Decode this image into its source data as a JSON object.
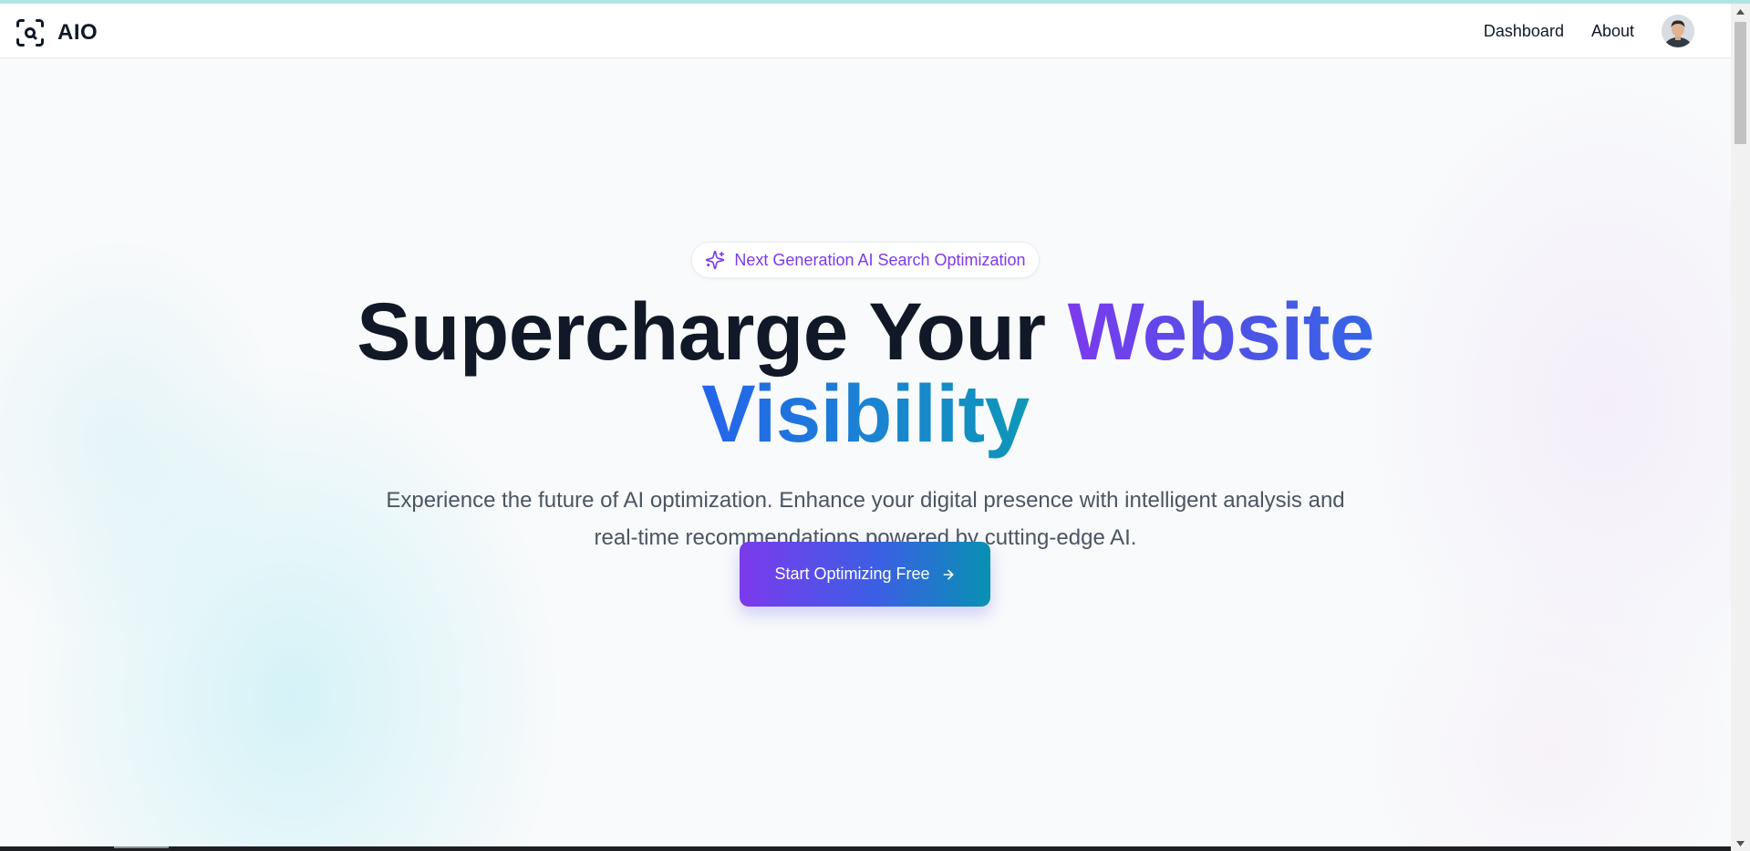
{
  "nav": {
    "brand": "AIO",
    "links": [
      "Dashboard",
      "About"
    ]
  },
  "hero": {
    "badge": "Next Generation AI Search Optimization",
    "headline_plain": "Supercharge Your ",
    "headline_accent_1": "Website",
    "headline_accent_2": "Visibility",
    "subtitle": "Experience the future of AI optimization. Enhance your digital presence with intelligent analysis and real-time recommendations powered by cutting-edge AI.",
    "cta_label": "Start Optimizing Free"
  },
  "icons": {
    "brand": "scan-search-icon",
    "badge": "sparkles-icon",
    "cta": "arrow-right-icon",
    "avatar": "user-avatar"
  },
  "colors": {
    "accent_purple": "#7c3aed",
    "accent_blue": "#2563eb",
    "accent_teal": "#0891b2",
    "text_dark": "#111827",
    "text_muted": "#4b5563"
  }
}
